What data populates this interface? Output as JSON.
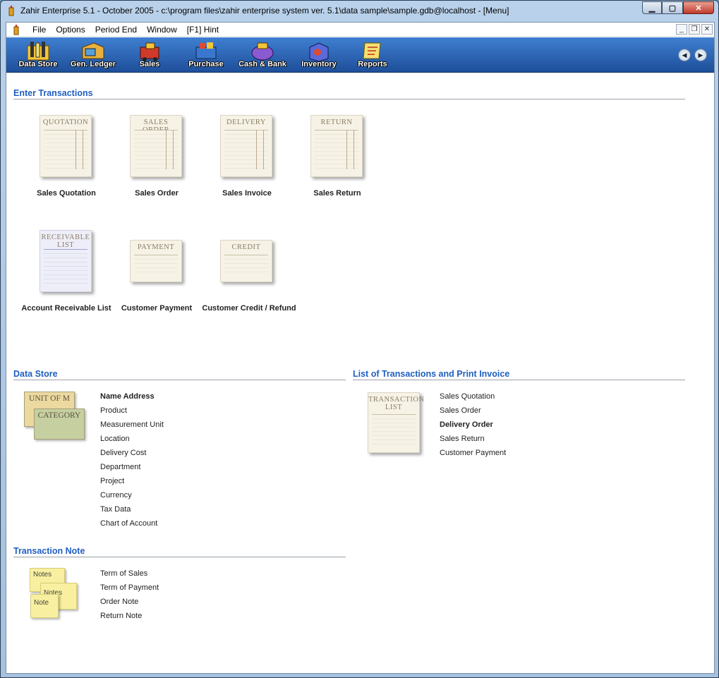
{
  "window": {
    "title": "Zahir Enterprise 5.1 - October 2005 - c:\\program files\\zahir enterprise system ver. 5.1\\data sample\\sample.gdb@localhost - [Menu]",
    "buttons": {
      "minimize": "▁",
      "maximize": "▢",
      "close": "✕"
    }
  },
  "menubar": {
    "items": [
      "File",
      "Options",
      "Period End",
      "Window",
      "[F1] Hint"
    ],
    "mdi": {
      "minimize": "_",
      "restore": "❐",
      "close": "✕"
    }
  },
  "toolbar": {
    "buttons": [
      {
        "label": "Data Store",
        "icon": "data-store-icon"
      },
      {
        "label": "Gen. Ledger",
        "icon": "ledger-icon"
      },
      {
        "label": "Sales",
        "icon": "sales-icon"
      },
      {
        "label": "Purchase",
        "icon": "purchase-icon"
      },
      {
        "label": "Cash & Bank",
        "icon": "cash-bank-icon"
      },
      {
        "label": "Inventory",
        "icon": "inventory-icon"
      },
      {
        "label": "Reports",
        "icon": "reports-icon"
      }
    ],
    "nav": {
      "back": "◀",
      "forward": "▶"
    }
  },
  "enter_transactions": {
    "title": "Enter Transactions",
    "items": [
      {
        "header": "QUOTATION",
        "label": "Sales Quotation"
      },
      {
        "header": "SALES ORDER",
        "label": "Sales Order"
      },
      {
        "header": "DELIVERY",
        "label": "Sales Invoice"
      },
      {
        "header": "RETURN",
        "label": "Sales Return"
      },
      {
        "header": "RECEIVABLE LIST",
        "label": "Account Receivable List"
      },
      {
        "header": "PAYMENT",
        "label": "Customer Payment"
      },
      {
        "header": "CREDIT",
        "label": "Customer Credit / Refund"
      }
    ]
  },
  "data_store": {
    "title": "Data Store",
    "card_front": "CATEGORY",
    "card_back": "UNIT OF M",
    "links": [
      "Name Address",
      "Product",
      "Measurement Unit",
      "Location",
      "Delivery Cost",
      "Department",
      "Project",
      "Currency",
      "Tax Data",
      "Chart of Account"
    ]
  },
  "list_transactions": {
    "title": "List of Transactions and  Print Invoice",
    "doc_header": "TRANSACTION LIST",
    "links": [
      "Sales Quotation",
      "Sales Order",
      "Delivery Order",
      "Sales Return",
      "Customer Payment"
    ]
  },
  "transaction_note": {
    "title": "Transaction Note",
    "note_front": "Notes",
    "note_back": "Notes",
    "note_left": "Note",
    "links": [
      "Term of Sales",
      "Term of Payment",
      "Order Note",
      "Return Note"
    ]
  },
  "colors": {
    "section_title": "#1f5fc0",
    "toolbar": "#2c63b4"
  }
}
